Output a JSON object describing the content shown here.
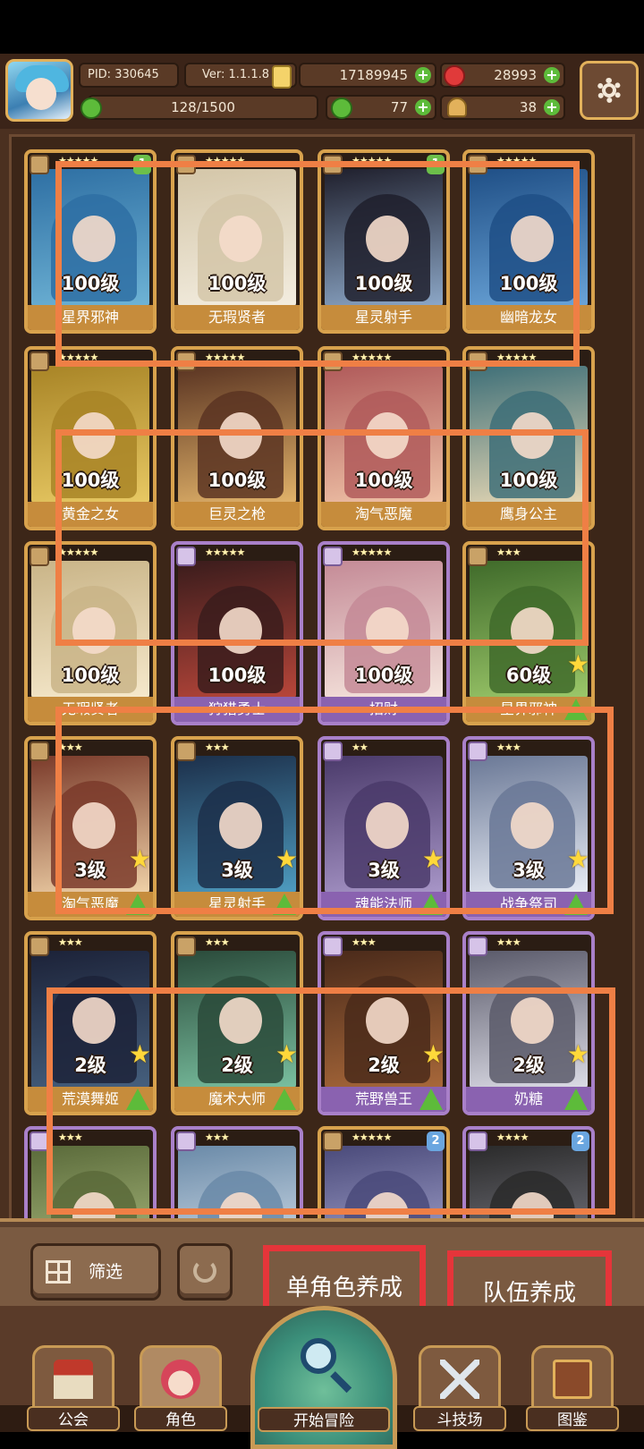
{
  "header": {
    "pid": "PID: 330645",
    "version": "Ver: 1.1.1.8",
    "energy": "128/1500",
    "gold": "17189945",
    "gems": "28993",
    "clover": "77",
    "key": "38"
  },
  "colors": {
    "gold_frame": "#d8a24d",
    "purple_frame": "#a980c9",
    "annotation_orange": "#ef7f45",
    "annotation_red": "#e5353a",
    "panel_brown": "#7a5a41"
  },
  "cards": [
    {
      "level": "100级",
      "name": "星界邪神",
      "stars": "★★★★★",
      "frame": "gold",
      "badge": "1",
      "art": [
        "#2e6fa3",
        "#6fb4d6"
      ]
    },
    {
      "level": "100级",
      "name": "无瑕贤者",
      "stars": "★★★★★",
      "frame": "gold",
      "badge": "",
      "art": [
        "#d4c6a8",
        "#f3ede0"
      ]
    },
    {
      "level": "100级",
      "name": "星灵射手",
      "stars": "★★★★★",
      "frame": "gold",
      "badge": "1",
      "art": [
        "#1f1f2c",
        "#8da8c8"
      ]
    },
    {
      "level": "100级",
      "name": "幽暗龙女",
      "stars": "★★★★★",
      "frame": "gold",
      "badge": "",
      "art": [
        "#1f4f86",
        "#6aa4d8"
      ]
    },
    {
      "level": "100级",
      "name": "黄金之女",
      "stars": "★★★★★",
      "frame": "gold",
      "badge": "",
      "art": [
        "#a88426",
        "#e8c964"
      ]
    },
    {
      "level": "100级",
      "name": "巨灵之枪",
      "stars": "★★★★★",
      "frame": "gold",
      "badge": "",
      "art": [
        "#5a3422",
        "#e2b36a"
      ]
    },
    {
      "level": "100级",
      "name": "淘气恶魔",
      "stars": "★★★★★",
      "frame": "gold",
      "badge": "",
      "art": [
        "#b05a5a",
        "#f0c4a8"
      ]
    },
    {
      "level": "100级",
      "name": "鹰身公主",
      "stars": "★★★★★",
      "frame": "gold",
      "badge": "",
      "art": [
        "#3e6f78",
        "#e9d9b5"
      ]
    },
    {
      "level": "100级",
      "name": "无瑕贤者",
      "stars": "★★★★★",
      "frame": "gold",
      "badge": "",
      "art": [
        "#c9b487",
        "#f6e9cc"
      ]
    },
    {
      "level": "100级",
      "name": "狩猎勇士",
      "stars": "★★★★★",
      "frame": "purple",
      "badge": "",
      "art": [
        "#3a1c1c",
        "#b8463a"
      ]
    },
    {
      "level": "100级",
      "name": "招财",
      "stars": "★★★★★",
      "frame": "purple",
      "badge": "",
      "art": [
        "#c48a96",
        "#f6e6de"
      ]
    },
    {
      "level": "60级",
      "name": "星界邪神",
      "stars": "★★★",
      "frame": "gold",
      "badge": "",
      "art": [
        "#3f6a2a",
        "#9cc86a"
      ]
    },
    {
      "level": "3级",
      "name": "淘气恶魔",
      "stars": "★★★",
      "frame": "gold",
      "badge": "",
      "art": [
        "#7a3a2a",
        "#f0d2a8"
      ]
    },
    {
      "level": "3级",
      "name": "星灵射手",
      "stars": "★★★",
      "frame": "gold",
      "badge": "",
      "art": [
        "#1c2f4a",
        "#4e9cc0"
      ]
    },
    {
      "level": "3级",
      "name": "魂能法师",
      "stars": "★★",
      "frame": "purple",
      "badge": "",
      "art": [
        "#4a3a6a",
        "#a896c8"
      ]
    },
    {
      "level": "3级",
      "name": "战争祭司",
      "stars": "★★★",
      "frame": "purple",
      "badge": "",
      "art": [
        "#6a7896",
        "#e8ecf4"
      ]
    },
    {
      "level": "2级",
      "name": "荒漠舞姬",
      "stars": "★★★",
      "frame": "gold",
      "badge": "",
      "art": [
        "#1c2238",
        "#46607e"
      ]
    },
    {
      "level": "2级",
      "name": "魔术大师",
      "stars": "★★★",
      "frame": "gold",
      "badge": "",
      "art": [
        "#2a4a3a",
        "#7ac0a0"
      ]
    },
    {
      "level": "2级",
      "name": "荒野兽王",
      "stars": "★★★",
      "frame": "purple",
      "badge": "",
      "art": [
        "#4a2a1a",
        "#a8683a"
      ]
    },
    {
      "level": "2级",
      "name": "奶糖",
      "stars": "★★★",
      "frame": "purple",
      "badge": "",
      "art": [
        "#5a5a6a",
        "#dcdce6"
      ]
    },
    {
      "level": "",
      "name": "",
      "stars": "★★★",
      "frame": "purple",
      "badge": "",
      "art": [
        "#5a6a3a",
        "#b8c88a"
      ]
    },
    {
      "level": "",
      "name": "",
      "stars": "★★★",
      "frame": "purple",
      "badge": "",
      "art": [
        "#6a8aa8",
        "#e6eef6"
      ]
    },
    {
      "level": "",
      "name": "",
      "stars": "★★★★★",
      "frame": "gold",
      "badge": "2",
      "art": [
        "#4a4a7a",
        "#b8b8e0"
      ]
    },
    {
      "level": "",
      "name": "",
      "stars": "★★★★",
      "frame": "purple",
      "badge": "2",
      "art": [
        "#2a2a2a",
        "#8a8a96"
      ]
    }
  ],
  "controls": {
    "filter_label": "筛选",
    "single_label": "单角色养成",
    "team_label": "队伍养成"
  },
  "nav": {
    "guild": "公会",
    "character": "角色",
    "adventure": "开始冒险",
    "arena": "斗技场",
    "codex": "图鉴"
  }
}
